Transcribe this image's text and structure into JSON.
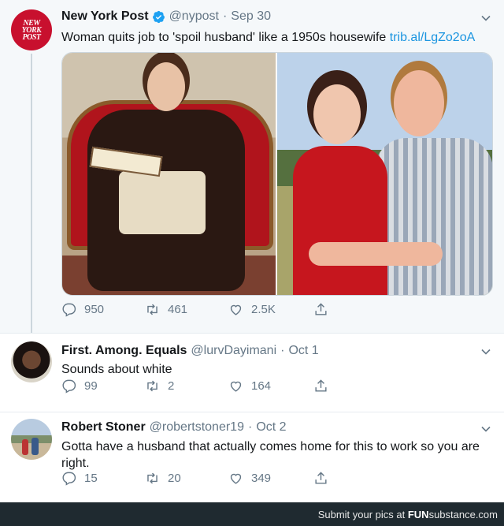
{
  "tweet": {
    "avatar_text": [
      "NEW",
      "YORK",
      "POST"
    ],
    "name": "New York Post",
    "handle": "@nypost",
    "separator": "·",
    "date": "Sep 30",
    "text": "Woman quits job to 'spoil husband' like a 1950s housewife",
    "link": "trib.al/LgZo2oA",
    "replies": "950",
    "retweets": "461",
    "likes": "2.5K"
  },
  "replies": [
    {
      "name": "First. Among. Equals",
      "handle": "@lurvDayimani",
      "separator": "·",
      "date": "Oct 1",
      "text": "Sounds about white",
      "replies": "99",
      "retweets": "2",
      "likes": "164"
    },
    {
      "name": "Robert Stoner",
      "handle": "@robertstoner19",
      "separator": "·",
      "date": "Oct 2",
      "text_line1": "Gotta have a husband that actually comes home for this to work so you are",
      "text_line2": "right.",
      "replies": "15",
      "retweets": "20",
      "likes": "349"
    }
  ],
  "footer": {
    "prefix": "Submit your pics at ",
    "brand_bold": "FUN",
    "brand_rest": "substance.com"
  },
  "colors": {
    "accent": "#1b95e0",
    "muted": "#657786",
    "brand": "#c8102e"
  },
  "icons": [
    "verified-badge-icon",
    "chevron-down-icon",
    "reply-icon",
    "retweet-icon",
    "like-icon",
    "share-icon"
  ]
}
